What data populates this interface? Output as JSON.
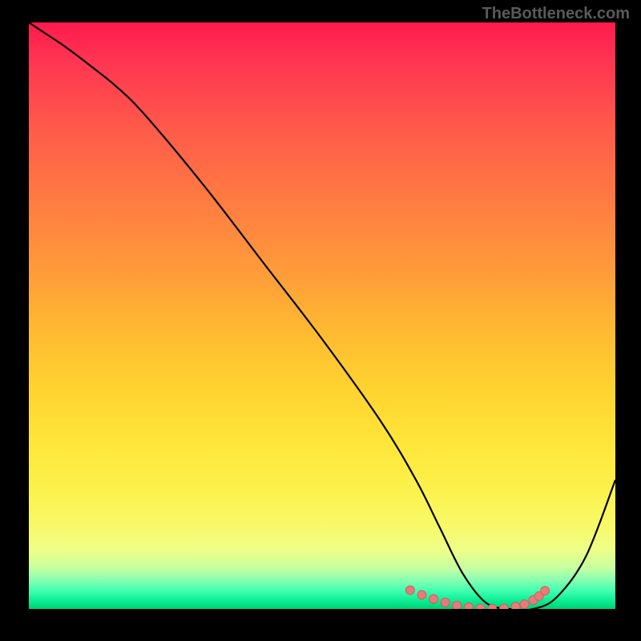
{
  "watermark": "TheBottleneck.com",
  "chart_data": {
    "type": "line",
    "title": "",
    "xlabel": "",
    "ylabel": "",
    "xlim": [
      0,
      100
    ],
    "ylim": [
      0,
      100
    ],
    "series": [
      {
        "name": "bottleneck-curve",
        "x": [
          0,
          3,
          6,
          10,
          15,
          20,
          30,
          40,
          50,
          60,
          66,
          70,
          74,
          78,
          82,
          86,
          90,
          95,
          100
        ],
        "values": [
          100,
          98,
          96,
          93,
          89,
          84,
          72,
          59,
          46,
          32,
          22,
          14,
          6,
          1,
          0,
          0,
          2,
          9,
          22
        ]
      }
    ],
    "markers": {
      "name": "highlight-dots",
      "x": [
        65,
        67,
        69,
        71,
        73,
        75,
        77,
        79,
        81,
        83,
        84.5,
        86,
        87,
        88
      ],
      "values": [
        3.2,
        2.4,
        1.7,
        1.1,
        0.6,
        0.3,
        0.1,
        0.05,
        0.1,
        0.4,
        0.8,
        1.5,
        2.2,
        3.1
      ]
    },
    "gradient_stops": [
      {
        "pct": 0,
        "color": "#ff1a4d"
      },
      {
        "pct": 50,
        "color": "#ffb832"
      },
      {
        "pct": 85,
        "color": "#f8f96a"
      },
      {
        "pct": 100,
        "color": "#00d070"
      }
    ]
  }
}
